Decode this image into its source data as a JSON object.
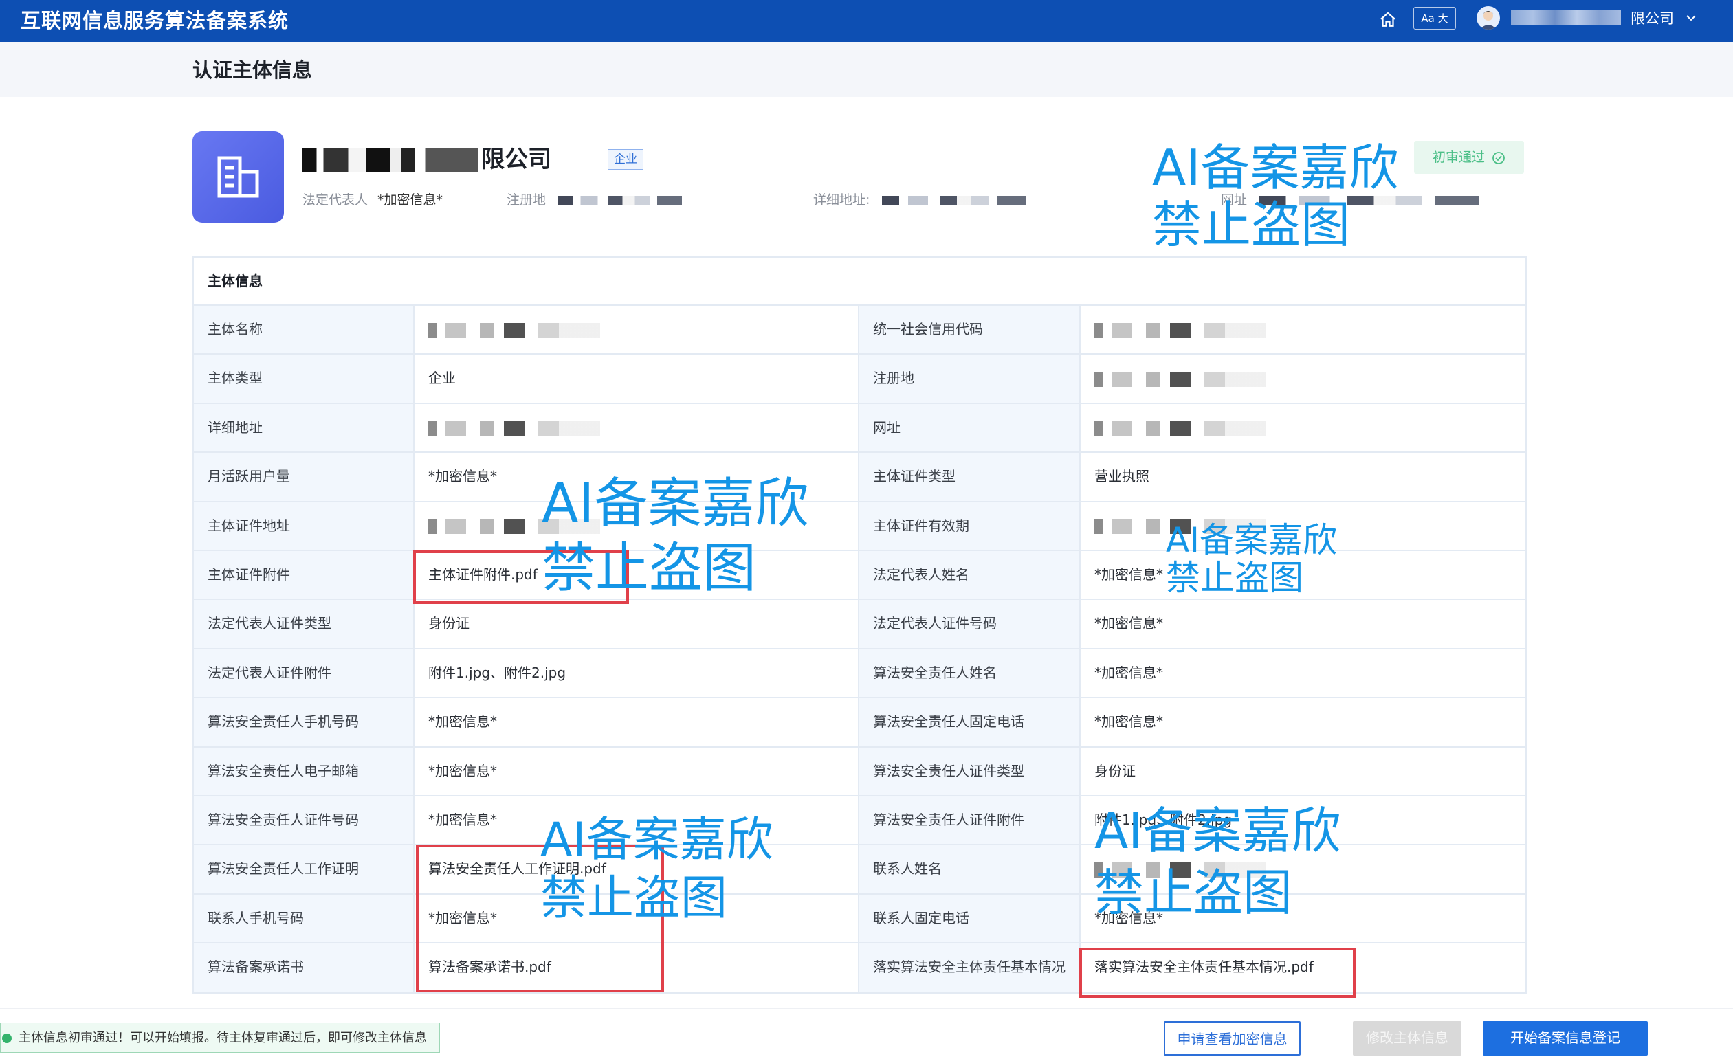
{
  "topbar": {
    "app_title": "互联网信息服务算法备案系统",
    "font_size_button": "Aa 大",
    "user_name": "限公司"
  },
  "page": {
    "title": "认证主体信息"
  },
  "company": {
    "name_visible": "限公司",
    "type_tag": "企业",
    "status": "初审通过",
    "legal_rep_label": "法定代表人",
    "legal_rep_value": "*加密信息*",
    "reg_place_label": "注册地",
    "address_label": "详细地址:",
    "website_label": "网址"
  },
  "table": {
    "section_title": "主体信息",
    "rows": [
      {
        "l1": "主体名称",
        "v1": "",
        "l2": "统一社会信用代码",
        "v2": ""
      },
      {
        "l1": "主体类型",
        "v1": "企业",
        "l2": "注册地",
        "v2": ""
      },
      {
        "l1": "详细地址",
        "v1": "",
        "l2": "网址",
        "v2": ""
      },
      {
        "l1": "月活跃用户量",
        "v1": "*加密信息*",
        "l2": "主体证件类型",
        "v2": "营业执照"
      },
      {
        "l1": "主体证件地址",
        "v1": "",
        "l2": "主体证件有效期",
        "v2": ""
      },
      {
        "l1": "主体证件附件",
        "v1": "主体证件附件.pdf",
        "l2": "法定代表人姓名",
        "v2": "*加密信息*"
      },
      {
        "l1": "法定代表人证件类型",
        "v1": "身份证",
        "l2": "法定代表人证件号码",
        "v2": "*加密信息*"
      },
      {
        "l1": "法定代表人证件附件",
        "v1": "附件1.jpg、附件2.jpg",
        "l2": "算法安全责任人姓名",
        "v2": "*加密信息*"
      },
      {
        "l1": "算法安全责任人手机号码",
        "v1": "*加密信息*",
        "l2": "算法安全责任人固定电话",
        "v2": "*加密信息*"
      },
      {
        "l1": "算法安全责任人电子邮箱",
        "v1": "*加密信息*",
        "l2": "算法安全责任人证件类型",
        "v2": "身份证"
      },
      {
        "l1": "算法安全责任人证件号码",
        "v1": "*加密信息*",
        "l2": "算法安全责任人证件附件",
        "v2": "附件1.jpg、附件2.jpg"
      },
      {
        "l1": "算法安全责任人工作证明",
        "v1": "算法安全责任人工作证明.pdf",
        "l2": "联系人姓名",
        "v2": ""
      },
      {
        "l1": "联系人手机号码",
        "v1": "*加密信息*",
        "l2": "联系人固定电话",
        "v2": "*加密信息*"
      },
      {
        "l1": "算法备案承诺书",
        "v1": "算法备案承诺书.pdf",
        "l2": "落实算法安全主体责任基本情况",
        "v2": "落实算法安全主体责任基本情况.pdf"
      }
    ]
  },
  "watermark": {
    "line1": "AI备案嘉欣",
    "line2": "禁止盗图"
  },
  "footer": {
    "notice": "主体信息初审通过！可以开始填报。待主体复审通过后，即可修改主体信息",
    "btn_view_encrypted": "申请查看加密信息",
    "btn_edit": "修改主体信息",
    "btn_start": "开始备案信息登记"
  },
  "colors": {
    "topbar": "#0d4fb3",
    "primary": "#1d6fe0",
    "watermark": "#1495e6",
    "highlight": "#e0404a",
    "success": "#4bbf87"
  }
}
